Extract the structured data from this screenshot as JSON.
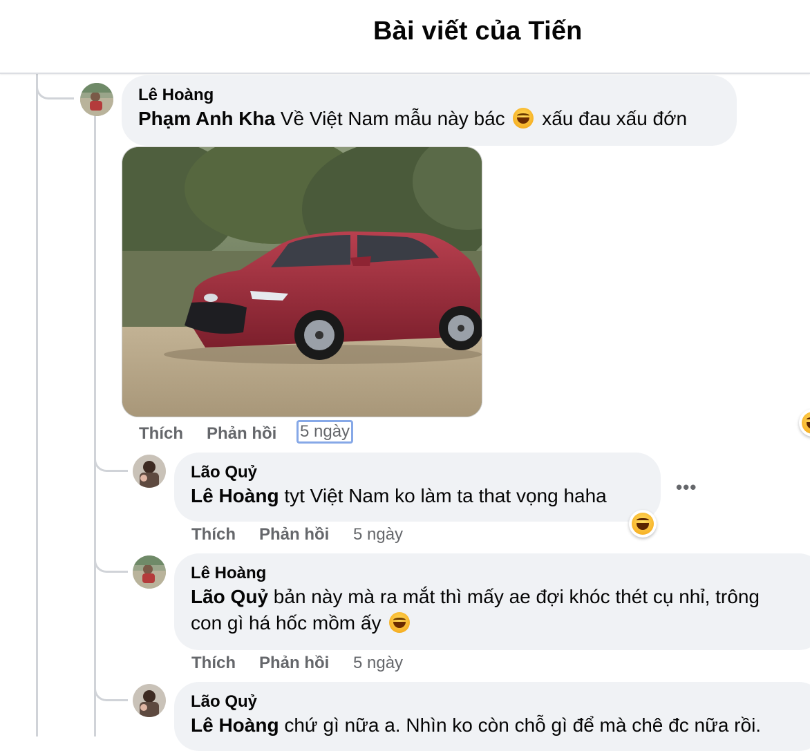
{
  "header": {
    "title": "Bài viết của Tiến"
  },
  "comments": [
    {
      "author": "Lê Hoàng",
      "mention": "Phạm Anh Kha",
      "text_before_emoji": "Về Việt Nam mẫu này bác",
      "text_after_emoji": "xấu đau xấu đớn",
      "emoji_icon": "joy-emoji",
      "has_photo": true,
      "photo_subject": "red-sedan-photo",
      "like_label": "Thích",
      "reply_label": "Phản hồi",
      "time": "5 ngày"
    },
    {
      "author": "Lão Quỷ",
      "mention": "Lê Hoàng",
      "text": "tyt Việt Nam ko làm ta that vọng haha",
      "reaction_icon": "haha-reaction",
      "more_icon": "more-dots-icon",
      "more_label": "•••",
      "like_label": "Thích",
      "reply_label": "Phản hồi",
      "time": "5 ngày"
    },
    {
      "author": "Lê Hoàng",
      "mention": "Lão Quỷ",
      "text_line1": "bản này mà ra mắt thì mấy ae đợi khóc thét cụ nhỉ, trông",
      "text_line2": "con gì há hốc mồm ấy",
      "emoji_icon": "joy-emoji",
      "like_label": "Thích",
      "reply_label": "Phản hồi",
      "time": "5 ngày"
    },
    {
      "author": "Lão Quỷ",
      "mention": "Lê Hoàng",
      "text": "chứ gì nữa a. Nhìn ko còn chỗ gì để mà chê đc nữa rồi."
    }
  ],
  "colors": {
    "bubble": "#f0f2f5",
    "meta_text": "#65676b",
    "thread_line": "#d0d3d8",
    "focus_ring": "#86a8e7"
  }
}
